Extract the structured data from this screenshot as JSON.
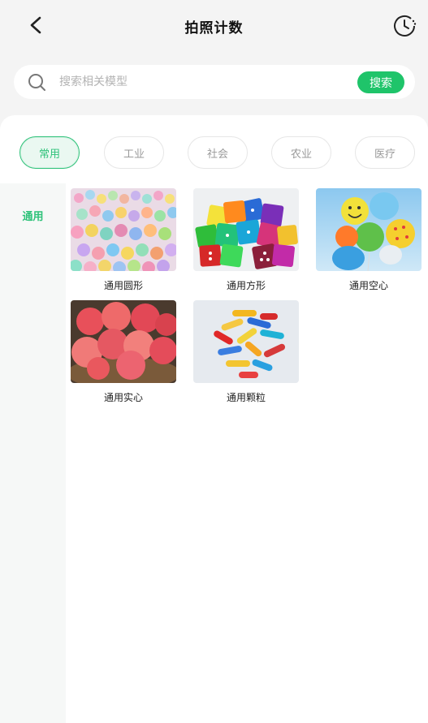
{
  "header": {
    "title": "拍照计数"
  },
  "search": {
    "placeholder": "搜索相关模型",
    "button_label": "搜索"
  },
  "tabs": [
    {
      "label": "常用",
      "active": true
    },
    {
      "label": "工业",
      "active": false
    },
    {
      "label": "社会",
      "active": false
    },
    {
      "label": "农业",
      "active": false
    },
    {
      "label": "医疗",
      "active": false
    }
  ],
  "sidebar": {
    "items": [
      {
        "label": "通用"
      }
    ]
  },
  "models": [
    {
      "label": "通用圆形"
    },
    {
      "label": "通用方形"
    },
    {
      "label": "通用空心"
    },
    {
      "label": "通用实心"
    },
    {
      "label": "通用颗粒"
    }
  ],
  "colors": {
    "accent": "#1fc46a",
    "active_tab": "#2fc27a"
  }
}
